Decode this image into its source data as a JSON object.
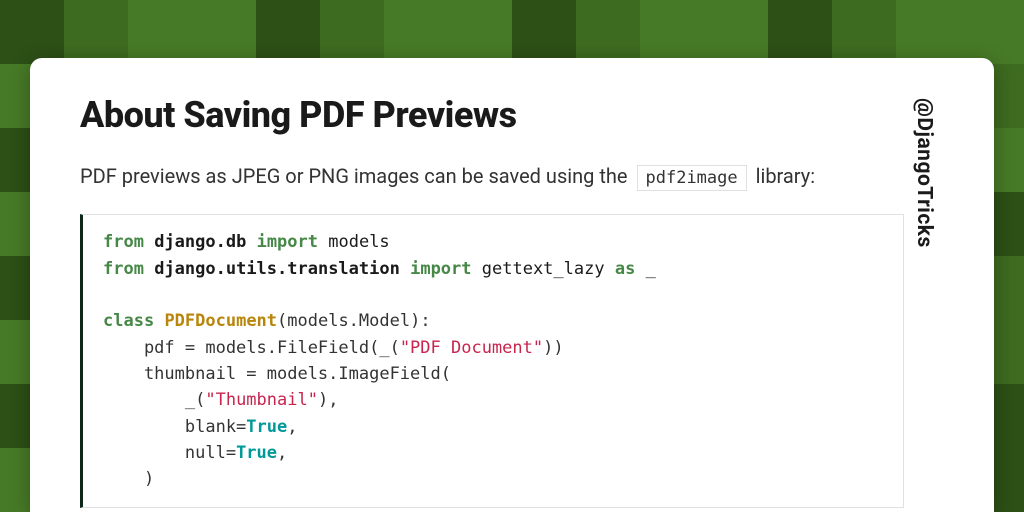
{
  "title": "About Saving PDF Previews",
  "intro": {
    "prefix": "PDF previews as JPEG or PNG images can be saved using the ",
    "code": "pdf2image",
    "suffix": " library:"
  },
  "handle": "@DjangoTricks",
  "code": {
    "kw_from1": "from",
    "mod1": "django.db",
    "kw_import1": "import",
    "name1": "models",
    "kw_from2": "from",
    "mod2": "django.utils.translation",
    "kw_import2": "import",
    "name2": "gettext_lazy",
    "kw_as": "as",
    "alias": "_",
    "kw_class": "class",
    "classname": "PDFDocument",
    "classbase": "(models.Model):",
    "line_pdf_pre": "    pdf = models.FileField(_(",
    "str_pdf": "\"PDF Document\"",
    "line_pdf_post": "))",
    "line_thumb": "    thumbnail = models.ImageField(",
    "line_thumblabel_pre": "        _(",
    "str_thumb": "\"Thumbnail\"",
    "line_thumblabel_post": "),",
    "line_blank_pre": "        blank=",
    "lit_true1": "True",
    "comma1": ",",
    "line_null_pre": "        null=",
    "lit_true2": "True",
    "comma2": ",",
    "line_close": "    )"
  }
}
